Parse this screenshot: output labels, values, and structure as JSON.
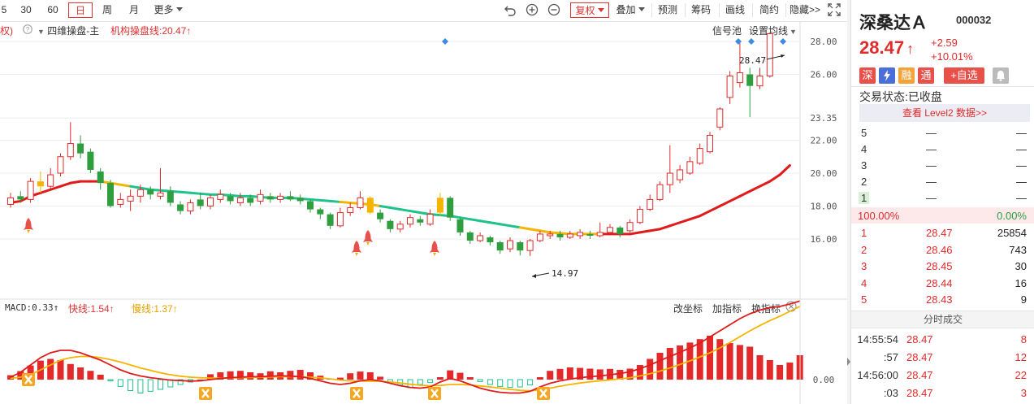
{
  "toolbar": {
    "periods": [
      "5",
      "30",
      "60",
      "日",
      "周",
      "月"
    ],
    "more": "更多",
    "fuquan": "复权",
    "diejia": "叠加",
    "yuce": "预测",
    "chouma": "筹码",
    "huaxian": "画线",
    "jianji": "简约",
    "yincang": "隐藏>>"
  },
  "main_info": {
    "left_cut": "权)",
    "indicator": "四维操盘-主",
    "line_label": "机构操盘线:20.47↑",
    "signal_pool": "信号池",
    "set_ma": "设置均线"
  },
  "macd_info": {
    "macd": "MACD:0.33↑",
    "fast": "快线:1.54↑",
    "slow": "慢线:1.37↑",
    "change_axis": "改坐标",
    "add_indicator": "加指标",
    "switch_indicator": "换指标"
  },
  "chart_data": [
    {
      "type": "candlestick",
      "y_ticks": [
        "28.00",
        "26.00",
        "23.35",
        "22.00",
        "20.00",
        "18.00",
        "16.00"
      ],
      "ylim": [
        14.6,
        29.0
      ],
      "annotations": {
        "high": "28.47",
        "low": "14.97"
      },
      "candles": [
        {
          "o": 18.1,
          "c": 18.5,
          "h": 18.8,
          "l": 17.9
        },
        {
          "o": 18.6,
          "c": 18.4,
          "h": 18.9,
          "l": 18.2
        },
        {
          "o": 18.4,
          "c": 19.5,
          "h": 19.7,
          "l": 18.2
        },
        {
          "o": 19.5,
          "c": 19.2,
          "h": 20.1,
          "l": 18.8
        },
        {
          "o": 19.2,
          "c": 19.9,
          "h": 20.3,
          "l": 19.0
        },
        {
          "o": 20.0,
          "c": 21.0,
          "h": 21.2,
          "l": 19.8
        },
        {
          "o": 21.0,
          "c": 21.8,
          "h": 23.1,
          "l": 20.8
        },
        {
          "o": 21.8,
          "c": 21.2,
          "h": 22.3,
          "l": 20.9
        },
        {
          "o": 21.3,
          "c": 20.2,
          "h": 21.5,
          "l": 20.0
        },
        {
          "o": 20.1,
          "c": 19.4,
          "h": 20.3,
          "l": 19.0
        },
        {
          "o": 19.4,
          "c": 18.0,
          "h": 19.6,
          "l": 17.9
        },
        {
          "o": 18.1,
          "c": 18.4,
          "h": 18.8,
          "l": 17.9
        },
        {
          "o": 18.3,
          "c": 18.6,
          "h": 19.0,
          "l": 17.7
        },
        {
          "o": 18.6,
          "c": 19.0,
          "h": 19.3,
          "l": 18.2
        },
        {
          "o": 19.0,
          "c": 18.7,
          "h": 19.2,
          "l": 18.4
        },
        {
          "o": 18.6,
          "c": 18.8,
          "h": 20.3,
          "l": 18.4
        },
        {
          "o": 18.9,
          "c": 18.2,
          "h": 19.2,
          "l": 18.0
        },
        {
          "o": 18.1,
          "c": 17.7,
          "h": 18.3,
          "l": 17.5
        },
        {
          "o": 17.7,
          "c": 18.2,
          "h": 18.4,
          "l": 17.5
        },
        {
          "o": 18.4,
          "c": 18.0,
          "h": 18.8,
          "l": 17.8
        },
        {
          "o": 18.0,
          "c": 18.5,
          "h": 18.7,
          "l": 17.8
        },
        {
          "o": 18.4,
          "c": 18.7,
          "h": 19.0,
          "l": 18.2
        },
        {
          "o": 18.6,
          "c": 18.3,
          "h": 18.8,
          "l": 18.1
        },
        {
          "o": 18.2,
          "c": 18.5,
          "h": 18.8,
          "l": 18.0
        },
        {
          "o": 18.5,
          "c": 18.2,
          "h": 18.7,
          "l": 18.0
        },
        {
          "o": 18.3,
          "c": 18.7,
          "h": 19.0,
          "l": 18.1
        },
        {
          "o": 18.6,
          "c": 18.4,
          "h": 18.8,
          "l": 18.2
        },
        {
          "o": 18.4,
          "c": 18.6,
          "h": 18.8,
          "l": 18.2
        },
        {
          "o": 18.6,
          "c": 18.4,
          "h": 18.9,
          "l": 18.3
        },
        {
          "o": 18.5,
          "c": 18.3,
          "h": 18.7,
          "l": 18.1
        },
        {
          "o": 18.3,
          "c": 17.8,
          "h": 18.4,
          "l": 17.6
        },
        {
          "o": 17.8,
          "c": 17.5,
          "h": 17.9,
          "l": 17.2
        },
        {
          "o": 17.5,
          "c": 16.8,
          "h": 17.6,
          "l": 16.6
        },
        {
          "o": 16.8,
          "c": 17.6,
          "h": 17.9,
          "l": 16.7
        },
        {
          "o": 17.6,
          "c": 17.9,
          "h": 18.2,
          "l": 17.4
        },
        {
          "o": 17.9,
          "c": 18.5,
          "h": 18.9,
          "l": 17.8
        },
        {
          "o": 18.5,
          "c": 17.6,
          "h": 18.6,
          "l": 17.5
        },
        {
          "o": 17.6,
          "c": 17.2,
          "h": 17.8,
          "l": 17.0
        },
        {
          "o": 17.1,
          "c": 16.6,
          "h": 17.2,
          "l": 16.4
        },
        {
          "o": 16.6,
          "c": 16.9,
          "h": 17.1,
          "l": 16.4
        },
        {
          "o": 16.9,
          "c": 17.3,
          "h": 17.5,
          "l": 16.7
        },
        {
          "o": 17.2,
          "c": 17.0,
          "h": 17.4,
          "l": 16.8
        },
        {
          "o": 16.9,
          "c": 17.5,
          "h": 17.8,
          "l": 16.8
        },
        {
          "o": 17.6,
          "c": 18.5,
          "h": 18.8,
          "l": 17.4
        },
        {
          "o": 18.5,
          "c": 17.3,
          "h": 18.6,
          "l": 17.1
        },
        {
          "o": 17.2,
          "c": 16.4,
          "h": 17.3,
          "l": 16.2
        },
        {
          "o": 16.4,
          "c": 15.9,
          "h": 16.5,
          "l": 15.7
        },
        {
          "o": 15.9,
          "c": 16.2,
          "h": 16.4,
          "l": 15.8
        },
        {
          "o": 16.1,
          "c": 15.8,
          "h": 16.2,
          "l": 15.6
        },
        {
          "o": 15.8,
          "c": 15.3,
          "h": 15.9,
          "l": 15.1
        },
        {
          "o": 15.4,
          "c": 15.9,
          "h": 16.1,
          "l": 15.2
        },
        {
          "o": 15.8,
          "c": 15.3,
          "h": 15.9,
          "l": 15.0
        },
        {
          "o": 15.3,
          "c": 15.9,
          "h": 16.0,
          "l": 14.97
        },
        {
          "o": 15.9,
          "c": 16.3,
          "h": 16.5,
          "l": 15.8
        },
        {
          "o": 16.2,
          "c": 16.3,
          "h": 16.5,
          "l": 16.0
        },
        {
          "o": 16.3,
          "c": 16.1,
          "h": 16.5,
          "l": 15.9
        },
        {
          "o": 16.1,
          "c": 16.3,
          "h": 16.5,
          "l": 16.0
        },
        {
          "o": 16.2,
          "c": 16.4,
          "h": 16.6,
          "l": 16.0
        },
        {
          "o": 16.3,
          "c": 16.2,
          "h": 16.5,
          "l": 16.0
        },
        {
          "o": 16.2,
          "c": 16.4,
          "h": 17.0,
          "l": 16.1
        },
        {
          "o": 16.4,
          "c": 16.7,
          "h": 16.9,
          "l": 16.3
        },
        {
          "o": 16.7,
          "c": 16.3,
          "h": 16.8,
          "l": 16.1
        },
        {
          "o": 16.5,
          "c": 17.0,
          "h": 17.2,
          "l": 16.4
        },
        {
          "o": 17.0,
          "c": 17.8,
          "h": 18.0,
          "l": 16.9
        },
        {
          "o": 17.8,
          "c": 18.4,
          "h": 18.7,
          "l": 17.7
        },
        {
          "o": 18.4,
          "c": 19.3,
          "h": 19.5,
          "l": 18.3
        },
        {
          "o": 19.3,
          "c": 20.0,
          "h": 21.7,
          "l": 18.8
        },
        {
          "o": 19.6,
          "c": 20.2,
          "h": 20.5,
          "l": 19.4
        },
        {
          "o": 20.0,
          "c": 20.7,
          "h": 21.0,
          "l": 19.9
        },
        {
          "o": 20.6,
          "c": 21.5,
          "h": 21.8,
          "l": 20.5
        },
        {
          "o": 21.3,
          "c": 22.3,
          "h": 22.5,
          "l": 21.2
        },
        {
          "o": 22.8,
          "c": 23.9,
          "h": 24.0,
          "l": 22.6
        },
        {
          "o": 24.6,
          "c": 25.9,
          "h": 26.2,
          "l": 24.2
        },
        {
          "o": 25.5,
          "c": 26.1,
          "h": 27.9,
          "l": 25.2
        },
        {
          "o": 26.0,
          "c": 25.3,
          "h": 26.4,
          "l": 23.4
        },
        {
          "o": 25.3,
          "c": 25.9,
          "h": 26.4,
          "l": 25.1
        },
        {
          "o": 25.9,
          "c": 28.47,
          "h": 28.47,
          "l": 25.8
        }
      ],
      "ma_line": [
        18.2,
        18.3,
        18.6,
        18.8,
        19.0,
        19.2,
        19.4,
        19.5,
        19.5,
        19.5,
        19.4,
        19.3,
        19.2,
        19.1,
        19.0,
        18.95,
        18.9,
        18.85,
        18.8,
        18.75,
        18.7,
        18.7,
        18.65,
        18.6,
        18.6,
        18.55,
        18.5,
        18.5,
        18.5,
        18.45,
        18.4,
        18.35,
        18.3,
        18.25,
        18.2,
        18.15,
        18.1,
        18.0,
        17.9,
        17.8,
        17.7,
        17.6,
        17.5,
        17.45,
        17.4,
        17.3,
        17.2,
        17.1,
        17.0,
        16.9,
        16.8,
        16.7,
        16.6,
        16.5,
        16.4,
        16.35,
        16.3,
        16.3,
        16.3,
        16.3,
        16.3,
        16.3,
        16.3,
        16.4,
        16.5,
        16.6,
        16.8,
        17.0,
        17.2,
        17.4,
        17.7,
        18.0,
        18.3,
        18.6,
        18.9,
        19.2,
        19.5,
        19.9,
        20.47
      ]
    },
    {
      "type": "bar",
      "name": "MACD",
      "y_ticks": [
        "0.00"
      ],
      "ylim": [
        -1.25,
        3.6
      ],
      "values": [
        0.18,
        0.35,
        0.58,
        0.78,
        0.85,
        0.8,
        0.64,
        0.5,
        0.36,
        0.2,
        -0.05,
        -0.28,
        -0.45,
        -0.55,
        -0.48,
        -0.4,
        -0.3,
        -0.2,
        -0.1,
        0.0,
        0.22,
        0.3,
        0.34,
        0.36,
        0.3,
        0.26,
        0.34,
        0.3,
        0.36,
        0.4,
        0.3,
        0.16,
        0.04,
        0.08,
        0.26,
        0.33,
        0.3,
        0.12,
        -0.1,
        -0.22,
        -0.33,
        -0.2,
        -0.12,
        0.1,
        0.38,
        0.28,
        0.1,
        -0.08,
        -0.2,
        -0.28,
        -0.32,
        -0.3,
        -0.22,
        0.1,
        0.36,
        0.44,
        0.5,
        0.48,
        0.45,
        0.42,
        0.44,
        0.4,
        0.45,
        0.6,
        0.85,
        1.1,
        1.3,
        1.4,
        1.52,
        1.66,
        1.8,
        1.66,
        1.5,
        1.42,
        1.35,
        1.0,
        0.8,
        0.6,
        0.7,
        1.0
      ],
      "fast": [
        0.1,
        0.3,
        0.6,
        0.9,
        1.1,
        1.2,
        1.2,
        1.1,
        0.95,
        0.8,
        0.6,
        0.4,
        0.25,
        0.15,
        0.08,
        0.03,
        -0.02,
        -0.04,
        -0.06,
        -0.05,
        0.0,
        0.05,
        0.08,
        0.1,
        0.12,
        0.12,
        0.14,
        0.16,
        0.14,
        0.12,
        0.05,
        -0.05,
        -0.15,
        -0.2,
        -0.15,
        -0.05,
        0.0,
        -0.05,
        -0.15,
        -0.25,
        -0.32,
        -0.35,
        -0.3,
        -0.1,
        0.05,
        -0.05,
        -0.2,
        -0.35,
        -0.45,
        -0.52,
        -0.55,
        -0.55,
        -0.48,
        -0.3,
        -0.15,
        -0.05,
        0.02,
        0.08,
        0.12,
        0.15,
        0.2,
        0.25,
        0.32,
        0.45,
        0.6,
        0.78,
        0.95,
        1.12,
        1.3,
        1.5,
        1.75,
        2.0,
        2.25,
        2.5,
        2.7,
        2.85,
        2.95,
        3.0,
        3.1,
        3.22
      ],
      "slow": [
        0.05,
        0.1,
        0.2,
        0.4,
        0.6,
        0.8,
        0.9,
        0.95,
        0.95,
        0.9,
        0.82,
        0.72,
        0.6,
        0.48,
        0.38,
        0.28,
        0.2,
        0.14,
        0.1,
        0.08,
        0.06,
        0.06,
        0.07,
        0.08,
        0.09,
        0.1,
        0.11,
        0.12,
        0.12,
        0.12,
        0.1,
        0.07,
        0.03,
        -0.02,
        -0.05,
        -0.06,
        -0.06,
        -0.07,
        -0.1,
        -0.14,
        -0.19,
        -0.23,
        -0.25,
        -0.24,
        -0.2,
        -0.2,
        -0.22,
        -0.26,
        -0.3,
        -0.35,
        -0.4,
        -0.44,
        -0.46,
        -0.42,
        -0.35,
        -0.27,
        -0.2,
        -0.14,
        -0.09,
        -0.05,
        -0.01,
        0.03,
        0.08,
        0.15,
        0.24,
        0.35,
        0.48,
        0.62,
        0.77,
        0.93,
        1.1,
        1.3,
        1.52,
        1.76,
        2.0,
        2.22,
        2.42,
        2.6,
        2.8,
        3.0
      ]
    }
  ],
  "stock": {
    "name": "深桑达Ａ",
    "code": "000032",
    "price": "28.47",
    "arrow": "↑",
    "change": "+2.59",
    "change_pct": "+10.01%",
    "badges": [
      "深",
      "融",
      "通"
    ],
    "add_watch": "+自选",
    "status_label": "交易状态:",
    "status_value": "已收盘",
    "level2": "查看 Level2 数据>>"
  },
  "orderbook": {
    "sell": [
      {
        "level": "5",
        "price": "—",
        "vol": "—"
      },
      {
        "level": "4",
        "price": "—",
        "vol": "—"
      },
      {
        "level": "3",
        "price": "—",
        "vol": "—"
      },
      {
        "level": "2",
        "price": "—",
        "vol": "—"
      },
      {
        "level": "1",
        "price": "—",
        "vol": "—"
      }
    ],
    "ratio_left": "100.00%",
    "ratio_right": "0.00%",
    "buy": [
      {
        "level": "1",
        "price": "28.47",
        "vol": "25854"
      },
      {
        "level": "2",
        "price": "28.46",
        "vol": "743"
      },
      {
        "level": "3",
        "price": "28.45",
        "vol": "30"
      },
      {
        "level": "4",
        "price": "28.44",
        "vol": "16"
      },
      {
        "level": "5",
        "price": "28.43",
        "vol": "9"
      }
    ]
  },
  "ticks": {
    "title": "分时成交",
    "rows": [
      {
        "time": "14:55:54",
        "price": "28.47",
        "vol": "8"
      },
      {
        "time": ":57",
        "price": "28.47",
        "vol": "12"
      },
      {
        "time": "14:56:00",
        "price": "28.47",
        "vol": "22"
      },
      {
        "time": ":03",
        "price": "28.47",
        "vol": "3"
      }
    ]
  },
  "colors": {
    "up": "#e32a2a",
    "down": "#2f9e3f",
    "ma_green": "#20c28c",
    "ma_yellow": "#f5b400",
    "ma_red": "#e01b1b",
    "macd_fast": "#e01b1b",
    "macd_slow": "#f5b400",
    "grid": "#ececec"
  },
  "icons": [
    "undo-icon",
    "zoom-in-icon",
    "zoom-out-icon",
    "fullscreen-icon",
    "rocket-icon",
    "x-signal-icon",
    "bell-icon",
    "lightning-icon"
  ]
}
